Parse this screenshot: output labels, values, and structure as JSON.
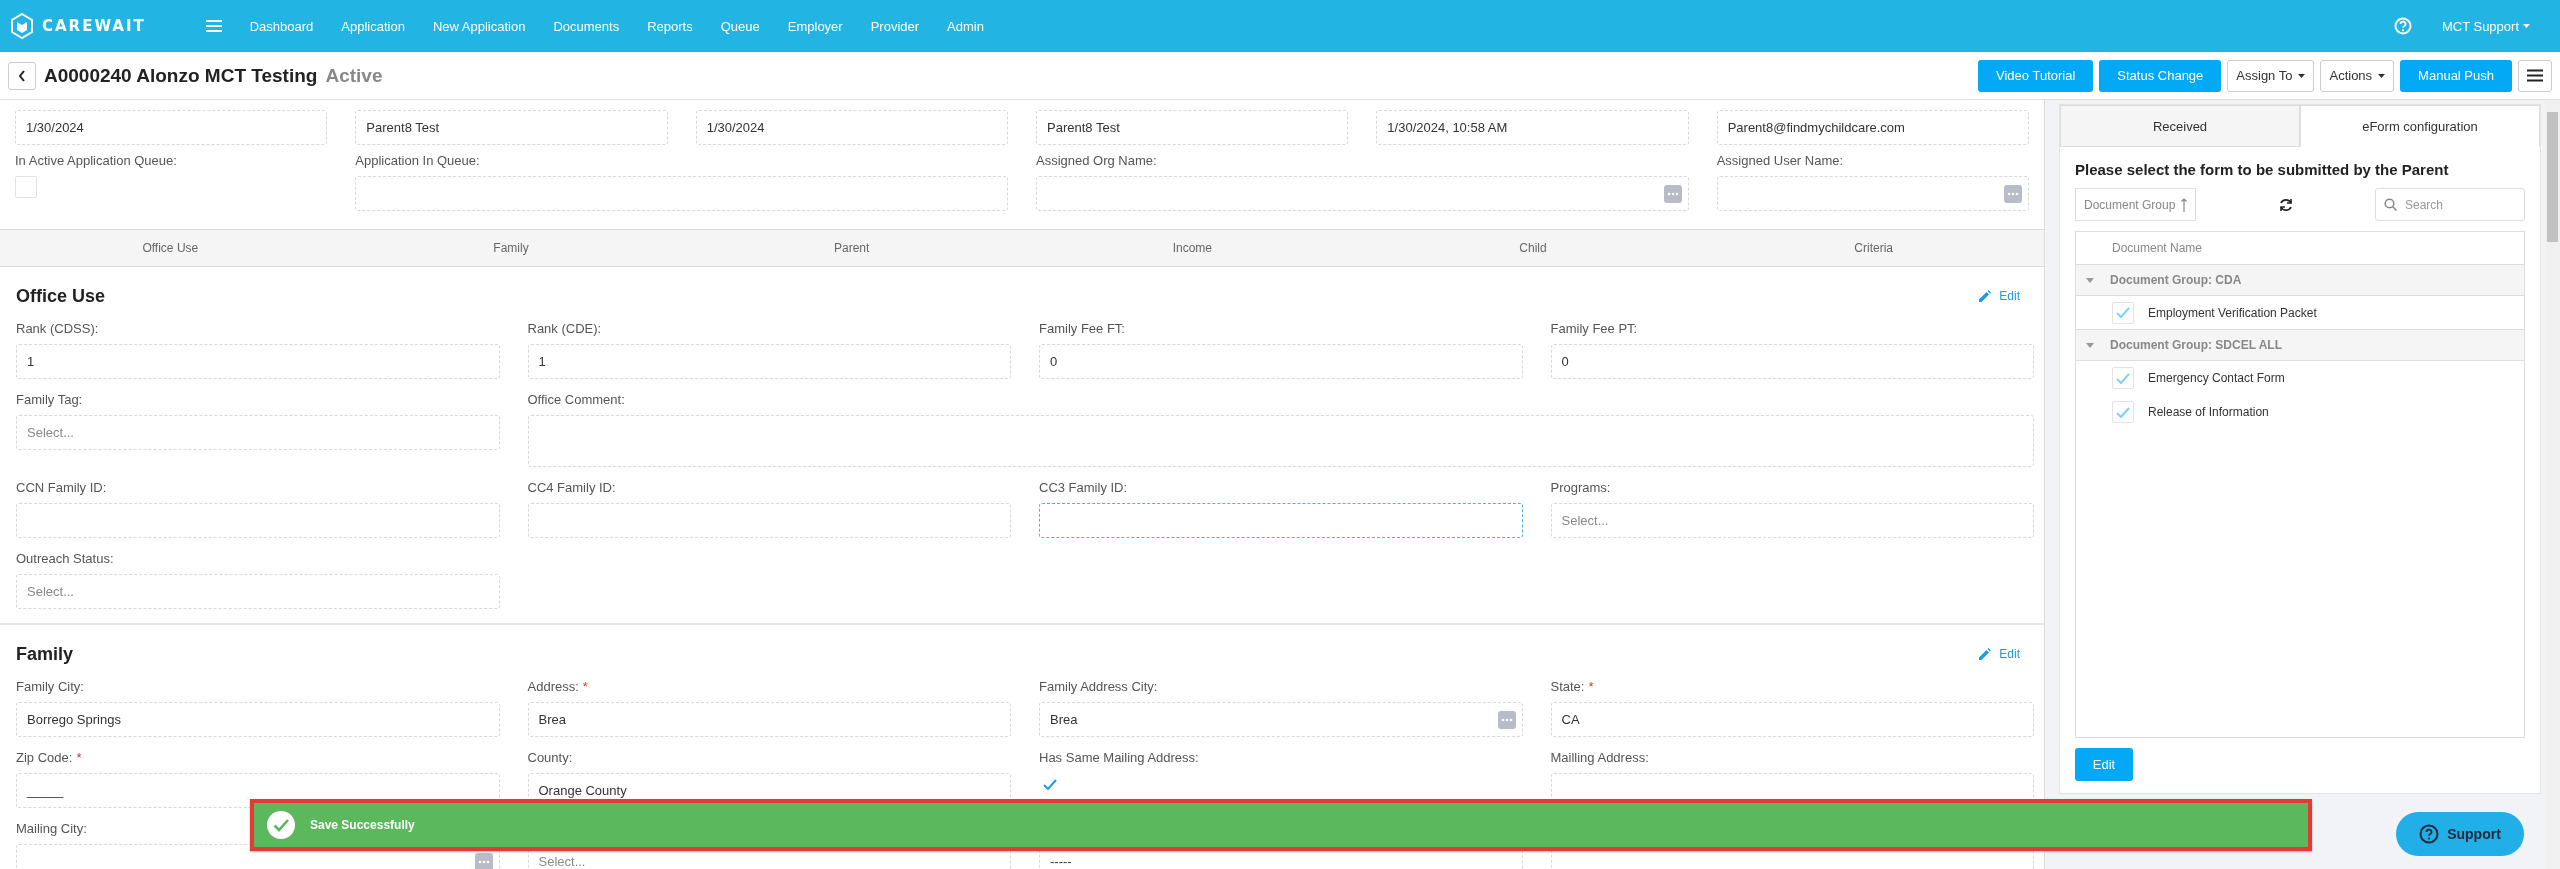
{
  "nav": {
    "brand": "CAREWAIT",
    "items": [
      "Dashboard",
      "Application",
      "New Application",
      "Documents",
      "Reports",
      "Queue",
      "Employer",
      "Provider",
      "Admin"
    ],
    "user": "MCT Support"
  },
  "header": {
    "title": "A0000240 Alonzo MCT Testing",
    "status": "Active",
    "buttons": [
      {
        "label": "Video Tutorial",
        "kind": "primary"
      },
      {
        "label": "Status Change",
        "kind": "primary"
      },
      {
        "label": "Assign To",
        "kind": "dropdown"
      },
      {
        "label": "Actions",
        "kind": "dropdown"
      },
      {
        "label": "Manual Push",
        "kind": "primary"
      }
    ]
  },
  "summary": {
    "values": [
      "1/30/2024",
      "Parent8 Test",
      "1/30/2024",
      "Parent8 Test",
      "1/30/2024, 10:58 AM",
      "Parent8@findmychildcare.com"
    ],
    "fields": [
      {
        "label": "In Active Application Queue:",
        "kind": "checkbox",
        "checked": false
      },
      {
        "label": "Application In Queue:",
        "kind": "wide-text"
      },
      {
        "label": "Assigned Org Name:",
        "kind": "wide-lookup"
      },
      {
        "label": "Assigned User Name:",
        "kind": "lookup"
      }
    ]
  },
  "section_tabs": [
    "Office Use",
    "Family",
    "Parent",
    "Income",
    "Child",
    "Criteria"
  ],
  "sections": [
    {
      "title": "Office Use",
      "edit": "Edit",
      "fields": [
        {
          "label": "Rank (CDSS):",
          "kind": "text",
          "value": "1"
        },
        {
          "label": "Rank (CDE):",
          "kind": "text",
          "value": "1"
        },
        {
          "label": "Family Fee FT:",
          "kind": "text",
          "value": "0"
        },
        {
          "label": "Family Fee PT:",
          "kind": "text",
          "value": "0"
        },
        {
          "label": "Family Tag:",
          "kind": "select",
          "placeholder": "Select..."
        },
        {
          "label": "Office Comment:",
          "kind": "textarea"
        },
        {
          "label": "CCN Family ID:",
          "kind": "text"
        },
        {
          "label": "CC4 Family ID:",
          "kind": "text"
        },
        {
          "label": "CC3 Family ID:",
          "kind": "text",
          "focused": true
        },
        {
          "label": "Programs:",
          "kind": "select",
          "placeholder": "Select..."
        },
        {
          "label": "Outreach Status:",
          "kind": "select",
          "placeholder": "Select..."
        }
      ]
    },
    {
      "title": "Family",
      "edit": "Edit",
      "fields": [
        {
          "label": "Family City:",
          "kind": "text",
          "value": "Borrego Springs"
        },
        {
          "label": "Address:",
          "mark": "*",
          "kind": "text",
          "value": "Brea"
        },
        {
          "label": "Family Address City:",
          "kind": "lookup",
          "value": "Brea"
        },
        {
          "label": "State:",
          "mark": "*",
          "kind": "text",
          "value": "CA"
        },
        {
          "label": "Zip Code:",
          "mark": "*",
          "kind": "text",
          "value": "_____"
        },
        {
          "label": "County:",
          "kind": "text",
          "value": "Orange County"
        },
        {
          "label": "Has Same Mailing Address:",
          "kind": "checkbox",
          "checked": true
        },
        {
          "label": "Mailling Address:",
          "kind": "text"
        },
        {
          "label": "Mailing City:",
          "kind": "lookup"
        },
        {
          "kind": "select",
          "placeholder": "Select..."
        },
        {
          "kind": "text",
          "value": "-----"
        },
        {
          "kind": "text"
        }
      ]
    }
  ],
  "panel": {
    "tabs": [
      {
        "label": "Received",
        "selected": false
      },
      {
        "label": "eForm configuration",
        "selected": true
      }
    ],
    "heading": "Please select the form to be submitted by the Parent",
    "group_button": "Document Group",
    "search_placeholder": "Search",
    "column": "Document Name",
    "groups": [
      {
        "title": "Document Group: CDA",
        "expanded": true,
        "items": [
          {
            "name": "Employment Verification Packet",
            "checked": true
          }
        ]
      },
      {
        "title": "Document Group: SDCEL ALL",
        "expanded": true,
        "items": [
          {
            "name": "Emergency Contact Form",
            "checked": true
          },
          {
            "name": "Release of Information",
            "checked": true
          }
        ]
      }
    ],
    "edit": "Edit"
  },
  "toast": {
    "message": "Save Successfully"
  },
  "support": "Support"
}
